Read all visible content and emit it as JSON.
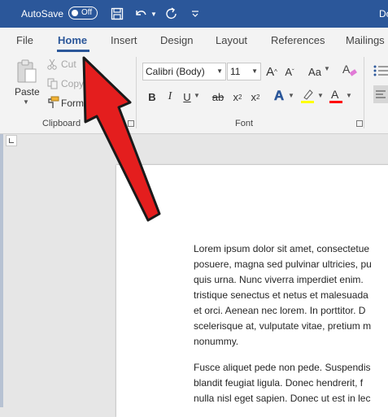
{
  "titlebar": {
    "autosave_label": "AutoSave",
    "autosave_state": "Off",
    "doc_title": "Do",
    "background": "#2b579a"
  },
  "tabs": [
    {
      "label": "File"
    },
    {
      "label": "Home",
      "active": true
    },
    {
      "label": "Insert"
    },
    {
      "label": "Design"
    },
    {
      "label": "Layout"
    },
    {
      "label": "References"
    },
    {
      "label": "Mailings"
    }
  ],
  "ribbon": {
    "clipboard": {
      "paste_label": "Paste",
      "cut_label": "Cut",
      "copy_label": "Copy",
      "format_painter_label": "Format Painter",
      "group_label": "Clipboard"
    },
    "font": {
      "font_name": "Calibri (Body)",
      "font_size": "11",
      "change_case_label": "Aa",
      "bold": "B",
      "italic": "I",
      "underline": "U",
      "strikethrough": "ab",
      "subscript": "x",
      "subscript_mark": "2",
      "superscript": "x",
      "superscript_mark": "2",
      "grow_label": "A",
      "shrink_label": "A",
      "text_effects": "A",
      "font_color": "A",
      "group_label": "Font",
      "highlight_color": "#ffff00",
      "font_color_bar": "#ff0000"
    }
  },
  "document": {
    "paragraph1": [
      "Lorem ipsum dolor sit amet, consectetue",
      "posuere, magna sed pulvinar ultricies, pu",
      "quis urna. Nunc viverra imperdiet enim.",
      "tristique senectus et netus et malesuada",
      "et orci. Aenean nec lorem. In porttitor. D",
      "scelerisque at, vulputate vitae, pretium m",
      "nonummy."
    ],
    "paragraph2": [
      "Fusce aliquet pede non pede. Suspendis",
      "blandit feugiat ligula. Donec hendrerit, f",
      "nulla nisl eget sapien. Donec ut est in lec"
    ]
  },
  "annotation": {
    "arrow_color": "#e41e1e"
  }
}
